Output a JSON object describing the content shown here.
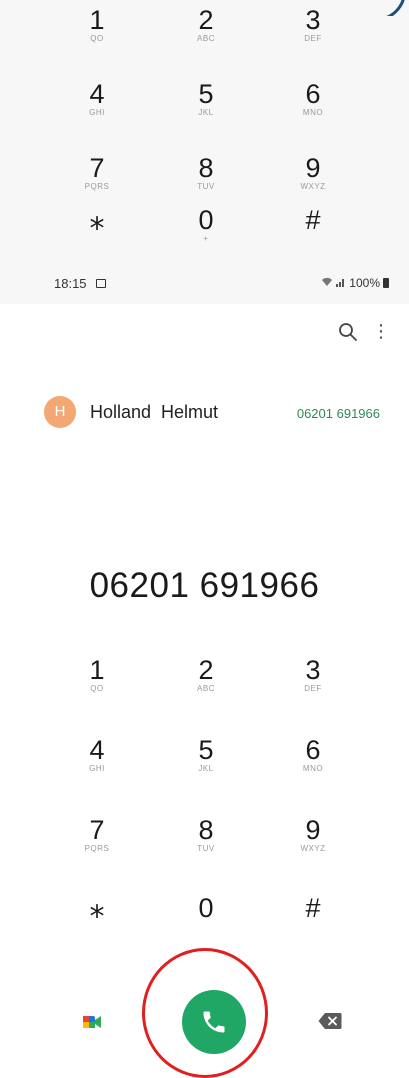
{
  "keypad": [
    {
      "num": "1",
      "sub": "ᵒᵒ"
    },
    {
      "num": "2",
      "sub": "ABC"
    },
    {
      "num": "3",
      "sub": "DEF"
    },
    {
      "num": "4",
      "sub": "GHI"
    },
    {
      "num": "5",
      "sub": "JKL"
    },
    {
      "num": "6",
      "sub": "MNO"
    },
    {
      "num": "7",
      "sub": "PQRS"
    },
    {
      "num": "8",
      "sub": "TUV"
    },
    {
      "num": "9",
      "sub": "WXYZ"
    },
    {
      "num": "⁎",
      "sub": ""
    },
    {
      "num": "0",
      "sub": "+"
    },
    {
      "num": "#",
      "sub": ""
    }
  ],
  "status_bar": {
    "time": "18:15",
    "battery": "100%"
  },
  "contact": {
    "initial": "H",
    "name": "Holland  Helmut",
    "number": "06201 691966",
    "avatar_color": "#f3a873"
  },
  "dialer": {
    "entered_number": "06201 691966"
  },
  "icons": {
    "search": "search-icon",
    "more": "more-options-icon",
    "video": "video-call-icon",
    "call": "phone-icon",
    "backspace": "backspace-icon"
  },
  "colors": {
    "call_button": "#20a766",
    "highlight_ring": "#e01f1f",
    "contact_number": "#2e8b57"
  }
}
